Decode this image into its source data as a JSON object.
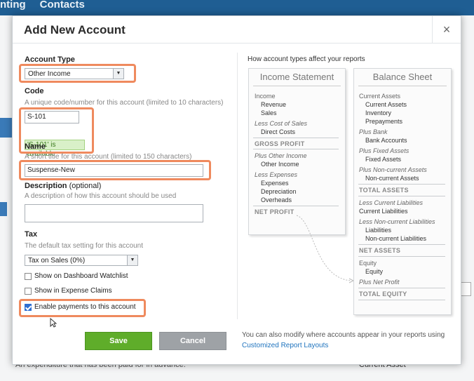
{
  "background": {
    "nav_items": [
      "nting",
      "Contacts"
    ],
    "bottom_text": "An expenditure that has been paid for in advance.",
    "bottom_right_text": "Current Asset"
  },
  "dialog": {
    "title": "Add New Account",
    "close": "×",
    "account_type": {
      "label": "Account Type",
      "value": "Other Income"
    },
    "code": {
      "label": "Code",
      "hint": "A unique code/number for this account (limited to 10 characters)",
      "value": "S-101",
      "availability": "'S-101' is available"
    },
    "name": {
      "label": "Name",
      "hint": "A short title for this account (limited to 150 characters)",
      "value": "Suspense-New"
    },
    "description": {
      "label": "Description",
      "optional": "(optional)",
      "hint": "A description of how this account should be used",
      "value": ""
    },
    "tax": {
      "label": "Tax",
      "hint": "The default tax setting for this account",
      "value": "Tax on Sales (0%)"
    },
    "checkboxes": [
      {
        "label": "Show on Dashboard Watchlist",
        "checked": false
      },
      {
        "label": "Show in Expense Claims",
        "checked": false
      },
      {
        "label": "Enable payments to this account",
        "checked": true
      }
    ],
    "save_label": "Save",
    "cancel_label": "Cancel",
    "footer_text": "You can also modify where accounts appear in your reports using",
    "footer_link": "Customized Report Layouts",
    "highlight_color": "#ef8a5e",
    "save_color": "#5fad2a"
  },
  "reports": {
    "title": "How account types affect your reports",
    "income_statement": {
      "title": "Income Statement",
      "lines": {
        "income": "Income",
        "revenue": "Revenue",
        "sales": "Sales",
        "less_cost": "Less Cost of Sales",
        "direct_costs": "Direct Costs",
        "gross_profit": "GROSS PROFIT",
        "plus_other": "Plus Other Income",
        "other_income": "Other Income",
        "less_expenses": "Less Expenses",
        "expenses": "Expenses",
        "depreciation": "Depreciation",
        "overheads": "Overheads",
        "net_profit": "NET PROFIT"
      }
    },
    "balance_sheet": {
      "title": "Balance Sheet",
      "lines": {
        "current_assets_h": "Current Assets",
        "current_assets": "Current Assets",
        "inventory": "Inventory",
        "prepayments": "Prepayments",
        "plus_bank": "Plus Bank",
        "bank_accounts": "Bank Accounts",
        "plus_fixed": "Plus Fixed Assets",
        "fixed_assets": "Fixed Assets",
        "plus_noncurrent": "Plus Non-current Assets",
        "noncurrent_assets": "Non-current Assets",
        "total_assets": "TOTAL ASSETS",
        "less_current_liab": "Less Current Liabilities",
        "current_liabilities": "Current Liabilities",
        "less_noncurrent_liab": "Less Non-current Liabilities",
        "liabilities": "Liabilities",
        "noncurrent_liabilities": "Non-current Liabilities",
        "net_assets": "NET ASSETS",
        "equity_h": "Equity",
        "equity": "Equity",
        "plus_net_profit": "Plus Net Profit",
        "total_equity": "TOTAL EQUITY"
      }
    }
  }
}
